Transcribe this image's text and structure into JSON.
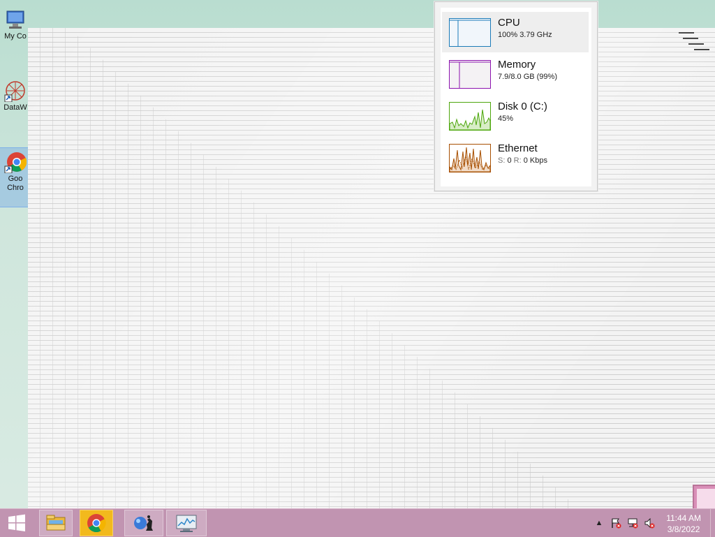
{
  "desktop": {
    "icons": [
      {
        "label": "My Co",
        "name": "my-computer"
      },
      {
        "label": "DataW",
        "name": "datawizard"
      },
      {
        "label": "Goo\nChro",
        "line1": "Goo",
        "line2": "Chro",
        "name": "google-chrome"
      }
    ]
  },
  "task_manager": {
    "resources": [
      {
        "name": "CPU",
        "value": "100%  3.79 GHz",
        "color": "#1b7bb8"
      },
      {
        "name": "Memory",
        "value": "7.9/8.0 GB (99%)",
        "color": "#8b12ae"
      },
      {
        "name": "Disk 0 (C:)",
        "value": "45%",
        "color": "#4da60c"
      },
      {
        "name": "Ethernet",
        "value_s": "S:",
        "value_s_num": "0",
        "value_r": "R:",
        "value_r_num": "0 Kbps",
        "color": "#a74f01"
      }
    ]
  },
  "taskbar": {
    "start": "start-icon",
    "apps": [
      {
        "name": "file-explorer-icon"
      },
      {
        "name": "chrome-icon",
        "active": true
      },
      {
        "name": "chess-app-icon"
      },
      {
        "name": "resource-monitor-icon"
      }
    ],
    "tray": [
      "show-hidden-icon",
      "action-center-icon",
      "network-icon",
      "volume-muted-icon"
    ],
    "clock": {
      "time": "11:44 AM",
      "date": "3/8/2022"
    }
  },
  "colors": {
    "taskbar": "#c194b1",
    "active_app": "#f2b91d"
  }
}
